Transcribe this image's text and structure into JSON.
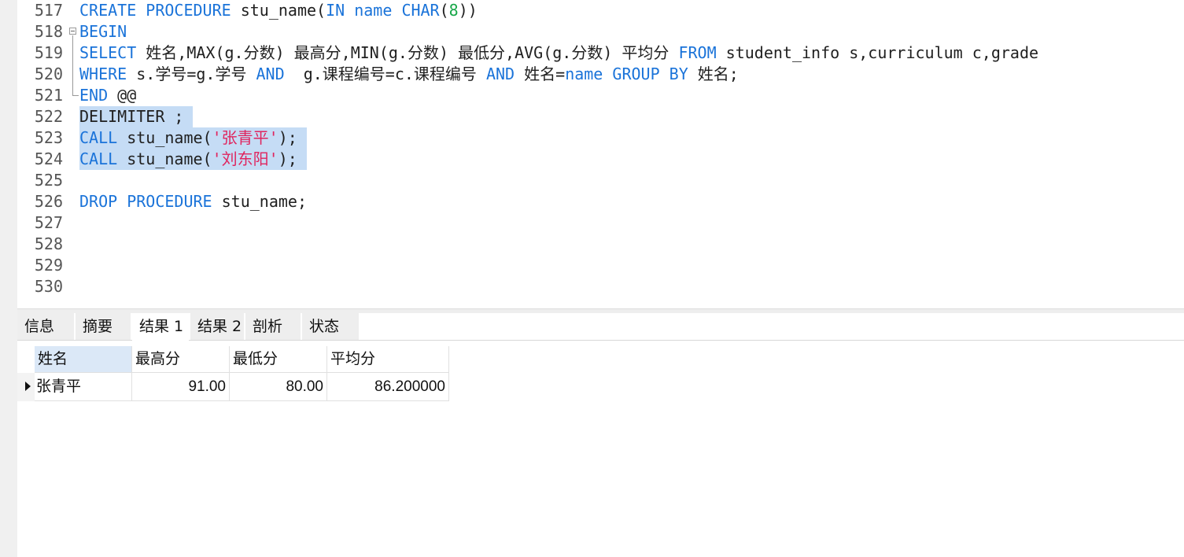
{
  "editor": {
    "lines": [
      {
        "num": "517",
        "segments": [
          {
            "t": "CREATE PROCEDURE",
            "c": "kw"
          },
          {
            "t": " stu_name(",
            "c": ""
          },
          {
            "t": "IN",
            "c": "kw"
          },
          {
            "t": " ",
            "c": ""
          },
          {
            "t": "name",
            "c": "kw"
          },
          {
            "t": " ",
            "c": ""
          },
          {
            "t": "CHAR",
            "c": "kw"
          },
          {
            "t": "(",
            "c": ""
          },
          {
            "t": "8",
            "c": "num"
          },
          {
            "t": "))",
            "c": ""
          }
        ]
      },
      {
        "num": "518",
        "segments": [
          {
            "t": "BEGIN",
            "c": "kw"
          }
        ]
      },
      {
        "num": "519",
        "segments": [
          {
            "t": "SELECT",
            "c": "kw"
          },
          {
            "t": " 姓名,MAX(g.分数) 最高分,MIN(g.分数) 最低分,AVG(g.分数) 平均分 ",
            "c": ""
          },
          {
            "t": "FROM",
            "c": "kw"
          },
          {
            "t": " student_info s,curriculum c,grade",
            "c": ""
          }
        ]
      },
      {
        "num": "520",
        "segments": [
          {
            "t": "WHERE",
            "c": "kw"
          },
          {
            "t": " s.学号=g.学号 ",
            "c": ""
          },
          {
            "t": "AND",
            "c": "kw"
          },
          {
            "t": "  g.课程编号=c.课程编号 ",
            "c": ""
          },
          {
            "t": "AND",
            "c": "kw"
          },
          {
            "t": " 姓名=",
            "c": ""
          },
          {
            "t": "name",
            "c": "kw"
          },
          {
            "t": " ",
            "c": ""
          },
          {
            "t": "GROUP BY",
            "c": "kw"
          },
          {
            "t": " 姓名;",
            "c": ""
          }
        ]
      },
      {
        "num": "521",
        "segments": [
          {
            "t": "END",
            "c": "kw"
          },
          {
            "t": " @@",
            "c": ""
          }
        ]
      },
      {
        "num": "522",
        "selected": true,
        "segments": [
          {
            "t": "DELIMITER ;",
            "c": ""
          }
        ]
      },
      {
        "num": "523",
        "selected": true,
        "segments": [
          {
            "t": "CALL",
            "c": "kw"
          },
          {
            "t": " stu_name(",
            "c": ""
          },
          {
            "t": "'张青平'",
            "c": "str"
          },
          {
            "t": ");",
            "c": ""
          }
        ]
      },
      {
        "num": "524",
        "selected": true,
        "segments": [
          {
            "t": "CALL",
            "c": "kw"
          },
          {
            "t": " stu_name(",
            "c": ""
          },
          {
            "t": "'刘东阳'",
            "c": "str"
          },
          {
            "t": ");",
            "c": ""
          }
        ]
      },
      {
        "num": "525",
        "segments": []
      },
      {
        "num": "526",
        "segments": [
          {
            "t": "DROP PROCEDURE",
            "c": "kw"
          },
          {
            "t": " stu_name;",
            "c": ""
          }
        ]
      },
      {
        "num": "527",
        "segments": []
      },
      {
        "num": "528",
        "segments": []
      },
      {
        "num": "529",
        "segments": []
      },
      {
        "num": "530",
        "segments": []
      }
    ]
  },
  "tabs": [
    {
      "label": "信息",
      "active": false
    },
    {
      "label": "摘要",
      "active": false
    },
    {
      "label": "结果 1",
      "active": true
    },
    {
      "label": "结果 2",
      "active": false
    },
    {
      "label": "剖析",
      "active": false
    },
    {
      "label": "状态",
      "active": false
    }
  ],
  "grid": {
    "columns": [
      "姓名",
      "最高分",
      "最低分",
      "平均分"
    ],
    "rows": [
      [
        "张青平",
        "91.00",
        "80.00",
        "86.200000"
      ]
    ]
  },
  "colors": {
    "keyword": "#1a73d9",
    "string": "#e0245e",
    "number": "#19a84a",
    "selection": "#c5dcf5"
  }
}
